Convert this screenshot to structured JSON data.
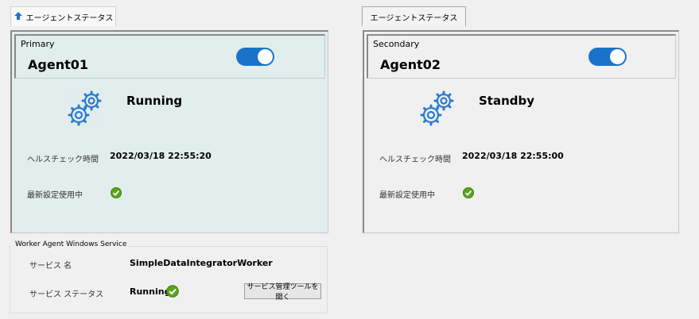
{
  "tabs": [
    {
      "label": "エージェントステータス",
      "icon": "agent-status-icon"
    },
    {
      "label": "エージェントステータス"
    }
  ],
  "primary": {
    "role": "Primary",
    "agent_name": "Agent01",
    "toggle_on": true,
    "state": "Running",
    "health_label": "ヘルスチェック時間",
    "health_time": "2022/03/18 22:55:20",
    "config_label": "最新設定使用中",
    "config_icon": "check-circle-icon"
  },
  "secondary": {
    "role": "Secondary",
    "agent_name": "Agent02",
    "toggle_on": true,
    "state": "Standby",
    "health_label": "ヘルスチェック時間",
    "health_time": "2022/03/18 22:55:00",
    "config_label": "最新設定使用中",
    "config_icon": "check-circle-icon"
  },
  "service": {
    "group_title": "Worker Agent Windows Service",
    "name_label": "サービス 名",
    "name_value": "SimpleDataIntegratorWorker",
    "status_label": "サービス ステータス",
    "status_value": "Running",
    "button_label": "サービス管理ツールを開く"
  },
  "colors": {
    "accent": "#1a73c9",
    "primary_panel_bg": "#e2eeed",
    "check_green": "#5aa51c"
  }
}
